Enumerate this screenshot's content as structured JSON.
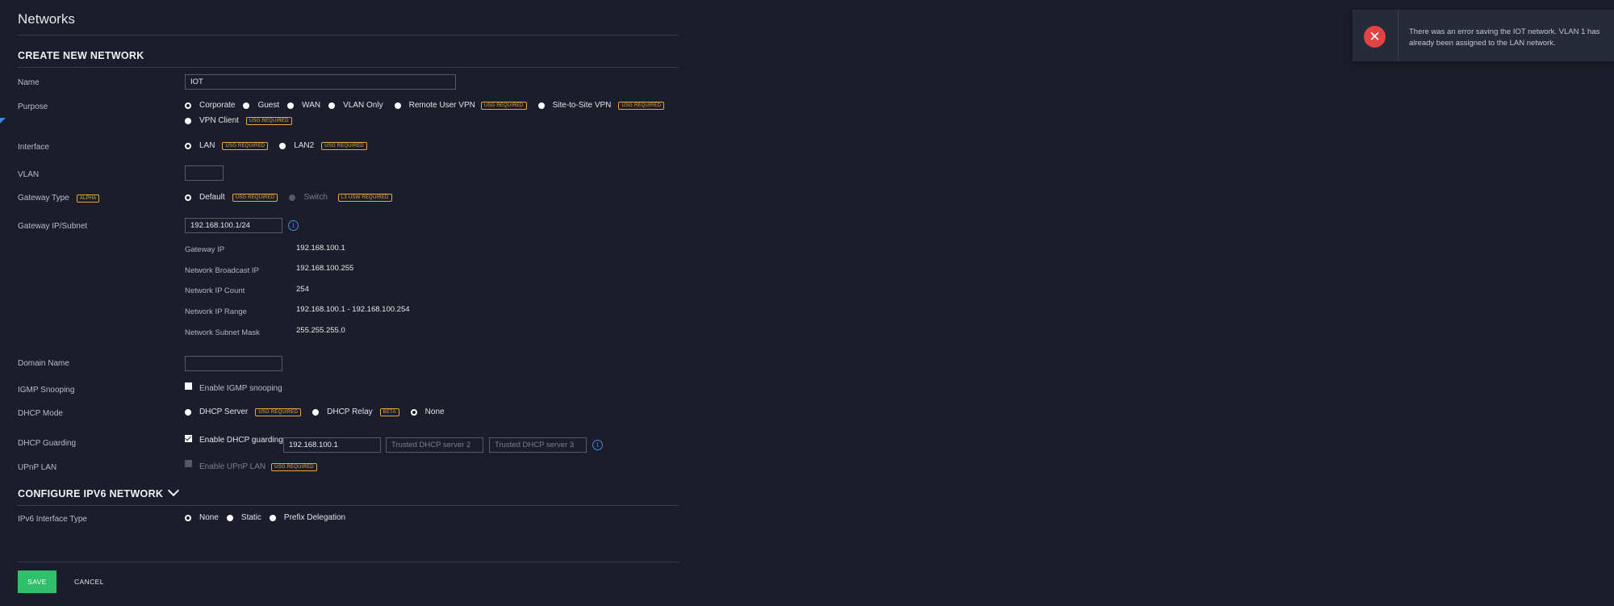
{
  "page": {
    "title": "Networks"
  },
  "create_section": {
    "title": "CREATE NEW NETWORK"
  },
  "fields": {
    "name": {
      "label": "Name",
      "value": "IOT"
    },
    "purpose": {
      "label": "Purpose",
      "options": [
        "Corporate",
        "Guest",
        "WAN",
        "VLAN Only",
        "Remote User VPN",
        "Site-to-Site VPN",
        "VPN Client"
      ],
      "selected": "Corporate"
    },
    "interface": {
      "label": "Interface",
      "options": [
        "LAN",
        "LAN2"
      ],
      "selected": "LAN"
    },
    "vlan": {
      "label": "VLAN",
      "value": ""
    },
    "gateway_type": {
      "label": "Gateway Type",
      "badge": "ALPHA",
      "options": [
        "Default",
        "Switch"
      ],
      "selected": "Default"
    },
    "gateway_subnet": {
      "label": "Gateway IP/Subnet",
      "value": "192.168.100.1/24"
    },
    "domain_name": {
      "label": "Domain Name",
      "value": ""
    },
    "igmp": {
      "label": "IGMP Snooping",
      "checkbox_label": "Enable IGMP snooping",
      "checked": false
    },
    "dhcp_mode": {
      "label": "DHCP Mode",
      "options": [
        "DHCP Server",
        "DHCP Relay",
        "None"
      ],
      "selected": "None",
      "relay_badge": "BETA"
    },
    "dhcp_guarding": {
      "label": "DHCP Guarding",
      "checkbox_label": "Enable DHCP guarding",
      "checked": true,
      "server1": "192.168.100.1",
      "server2_placeholder": "Trusted DHCP server 2",
      "server3_placeholder": "Trusted DHCP server 3"
    },
    "upnp": {
      "label": "UPnP LAN",
      "checkbox_label": "Enable UPnP LAN",
      "checked": false,
      "disabled": true
    }
  },
  "badges": {
    "usg_required": "USG REQUIRED",
    "l3_usw_required": "L3 USW REQUIRED"
  },
  "subnet_details": [
    {
      "label": "Gateway IP",
      "value": "192.168.100.1"
    },
    {
      "label": "Network Broadcast IP",
      "value": "192.168.100.255"
    },
    {
      "label": "Network IP Count",
      "value": "254"
    },
    {
      "label": "Network IP Range",
      "value": "192.168.100.1 - 192.168.100.254"
    },
    {
      "label": "Network Subnet Mask",
      "value": "255.255.255.0"
    }
  ],
  "ipv6_section": {
    "title": "CONFIGURE IPV6 NETWORK",
    "interface_type": {
      "label": "IPv6 Interface Type",
      "options": [
        "None",
        "Static",
        "Prefix Delegation"
      ],
      "selected": "None"
    }
  },
  "actions": {
    "save": "SAVE",
    "cancel": "CANCEL"
  },
  "toast": {
    "message": "There was an error saving the IOT network. VLAN 1 has already been assigned to the LAN network.",
    "icon": "close-icon"
  },
  "colors": {
    "accent": "#3f8ae6",
    "save": "#2ec06a",
    "badge": "#e8a640",
    "error": "#e24343"
  }
}
